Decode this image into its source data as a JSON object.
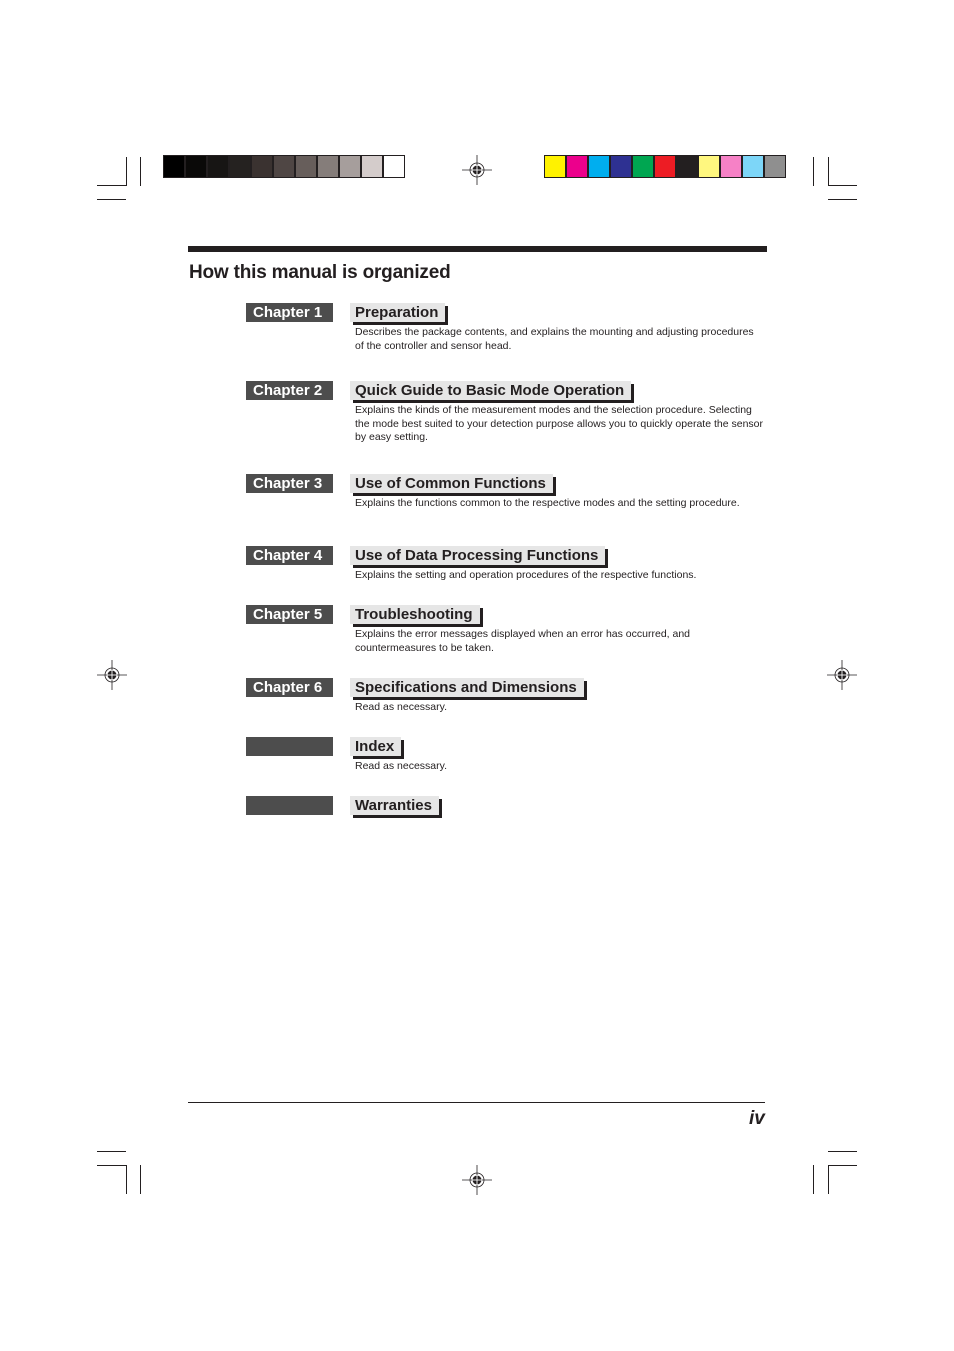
{
  "print_marks": {
    "grayscale_swatches": [
      "#000000",
      "#0a0908",
      "#171514",
      "#252220",
      "#3a3230",
      "#4f4644",
      "#675e5b",
      "#857d7a",
      "#a69e9c",
      "#d4cccb",
      "#ffffff"
    ],
    "color_swatches": [
      "#fff200",
      "#ec008c",
      "#00aeef",
      "#2e3192",
      "#00a651",
      "#ed1c24",
      "#231f20",
      "#fff77f",
      "#f681c6",
      "#7dd6f8",
      "#8f8f8f"
    ]
  },
  "page": {
    "title": "How this manual is organized",
    "page_number": "iv"
  },
  "entries": [
    {
      "chapter": "Chapter 1",
      "title": "Preparation",
      "description": "Describes the package contents, and explains the mounting and adjusting procedures of the controller and sensor head."
    },
    {
      "chapter": "Chapter 2",
      "title": "Quick Guide to Basic Mode Operation",
      "description": "Explains the kinds of the measurement modes and the selection procedure. Selecting the mode best suited to your detection purpose allows you to quickly operate the sensor by easy setting."
    },
    {
      "chapter": "Chapter 3",
      "title": "Use of Common Functions",
      "description": "Explains the functions common to the respective modes and the setting procedure."
    },
    {
      "chapter": "Chapter 4",
      "title": "Use of Data Processing Functions",
      "description": "Explains the setting and operation procedures of the respective functions."
    },
    {
      "chapter": "Chapter 5",
      "title": "Troubleshooting",
      "description": "Explains the error messages displayed when an error has occurred, and countermeasures to be taken."
    },
    {
      "chapter": "Chapter 6",
      "title": "Specifications and Dimensions",
      "description": "Read as necessary."
    },
    {
      "chapter": "",
      "title": "Index",
      "description": "Read as necessary."
    },
    {
      "chapter": "",
      "title": "Warranties",
      "description": ""
    }
  ]
}
